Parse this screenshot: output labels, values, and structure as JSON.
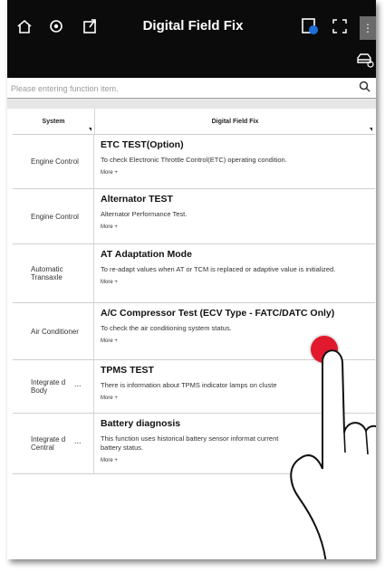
{
  "header": {
    "title": "Digital Field Fix",
    "icons": [
      "home-icon",
      "settings-icon",
      "export-icon",
      "vci-icon",
      "fullscreen-icon",
      "more-icon",
      "car-icon"
    ]
  },
  "search": {
    "placeholder": "Please entering function item."
  },
  "table": {
    "columns": {
      "system": "System",
      "fix": "Digital Field Fix"
    },
    "rows": [
      {
        "system": "Engine Control",
        "title": "ETC TEST(Option)",
        "desc": "To check Electronic Throttle Control(ETC) operating condition.",
        "more": "More +"
      },
      {
        "system": "Engine Control",
        "title": "Alternator TEST",
        "desc": "Alternator Performance Test.",
        "more": "More +"
      },
      {
        "system": "Automatic Transaxle",
        "title": "AT Adaptation Mode",
        "desc": "To re-adapt values when AT or TCM is replaced or adaptive value is initialized.",
        "more": "More +"
      },
      {
        "system": "Air Conditioner",
        "title": "A/C Compressor Test (ECV Type - FATC/DATC Only)",
        "desc": "To check the air conditioning system status.",
        "more": "More +"
      },
      {
        "system": "Integrate d Body",
        "title": "TPMS TEST",
        "desc": "There is information about TPMS indicator lamps on cluste",
        "more": "More +",
        "dots": "..."
      },
      {
        "system": "Integrate d Central",
        "title": "Battery diagnosis",
        "desc": "This function uses historical battery sensor informat current battery status.",
        "more": "More +",
        "dots": "..."
      }
    ]
  },
  "colors": {
    "topbar": "#0b0b0b",
    "touch": "#e2182c"
  }
}
